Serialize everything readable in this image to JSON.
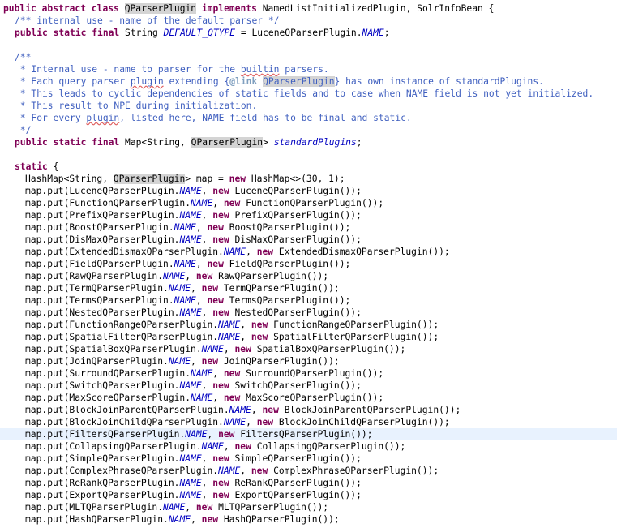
{
  "code": {
    "decl": {
      "kw_public": "public",
      "kw_abstract": "abstract",
      "kw_class": "class",
      "class_name": "QParserPlugin",
      "kw_implements": "implements",
      "interfaces": "NamedListInitializedPlugin, SolrInfoBean {"
    },
    "comment_default_qtype": "/** internal use - name of the default parser */",
    "default_qtype_line": {
      "mods": "public static final",
      "type": "String",
      "field": "DEFAULT_QTYPE",
      "assign": " = LuceneQParserPlugin.",
      "value_field": "NAME",
      "end": ";"
    },
    "javadoc": {
      "open": "/**",
      "l1_a": " * Internal use - name to parser for the ",
      "l1_spell": "builtin",
      "l1_b": " parsers.",
      "l2_a": " * Each query parser ",
      "l2_spell": "plugin",
      "l2_b": " extending {",
      "l2_tag": "@link",
      "l2_ref": "QParserPlugin",
      "l2_c": "} has own instance of standardPlugins.",
      "l3": " * This leads to cyclic dependencies of static fields and to case when NAME field is not yet initialized.",
      "l4": " * This result to NPE during initialization.",
      "l5_a": " * For every ",
      "l5_spell": "plugin",
      "l5_b": ", listed here, NAME field has to be final and static.",
      "close": " */"
    },
    "standard_plugins_line": {
      "mods": "public static final",
      "type_a": "Map<String, ",
      "type_ref": "QParserPlugin",
      "type_b": "> ",
      "field": "standardPlugins",
      "end": ";"
    },
    "static_block": {
      "kw_static": "static",
      "brace": " {"
    },
    "hashmap_line": {
      "type_a": "HashMap<String, ",
      "type_ref": "QParserPlugin",
      "type_b": "> map = ",
      "kw_new": "new",
      "rest": " HashMap<>(30, 1);"
    },
    "map_put_prefix": "map.put(",
    "name_field": "NAME",
    "kw_new": "new",
    "plugins": [
      "LuceneQParserPlugin",
      "FunctionQParserPlugin",
      "PrefixQParserPlugin",
      "BoostQParserPlugin",
      "DisMaxQParserPlugin",
      "ExtendedDismaxQParserPlugin",
      "FieldQParserPlugin",
      "RawQParserPlugin",
      "TermQParserPlugin",
      "TermsQParserPlugin",
      "NestedQParserPlugin",
      "FunctionRangeQParserPlugin",
      "SpatialFilterQParserPlugin",
      "SpatialBoxQParserPlugin",
      "JoinQParserPlugin",
      "SurroundQParserPlugin",
      "SwitchQParserPlugin",
      "MaxScoreQParserPlugin",
      "BlockJoinParentQParserPlugin",
      "BlockJoinChildQParserPlugin",
      "FiltersQParserPlugin",
      "CollapsingQParserPlugin",
      "SimpleQParserPlugin",
      "ComplexPhraseQParserPlugin",
      "ReRankQParserPlugin",
      "ExportQParserPlugin",
      "MLTQParserPlugin",
      "HashQParserPlugin"
    ],
    "current_line_plugin": "FiltersQParserPlugin"
  }
}
